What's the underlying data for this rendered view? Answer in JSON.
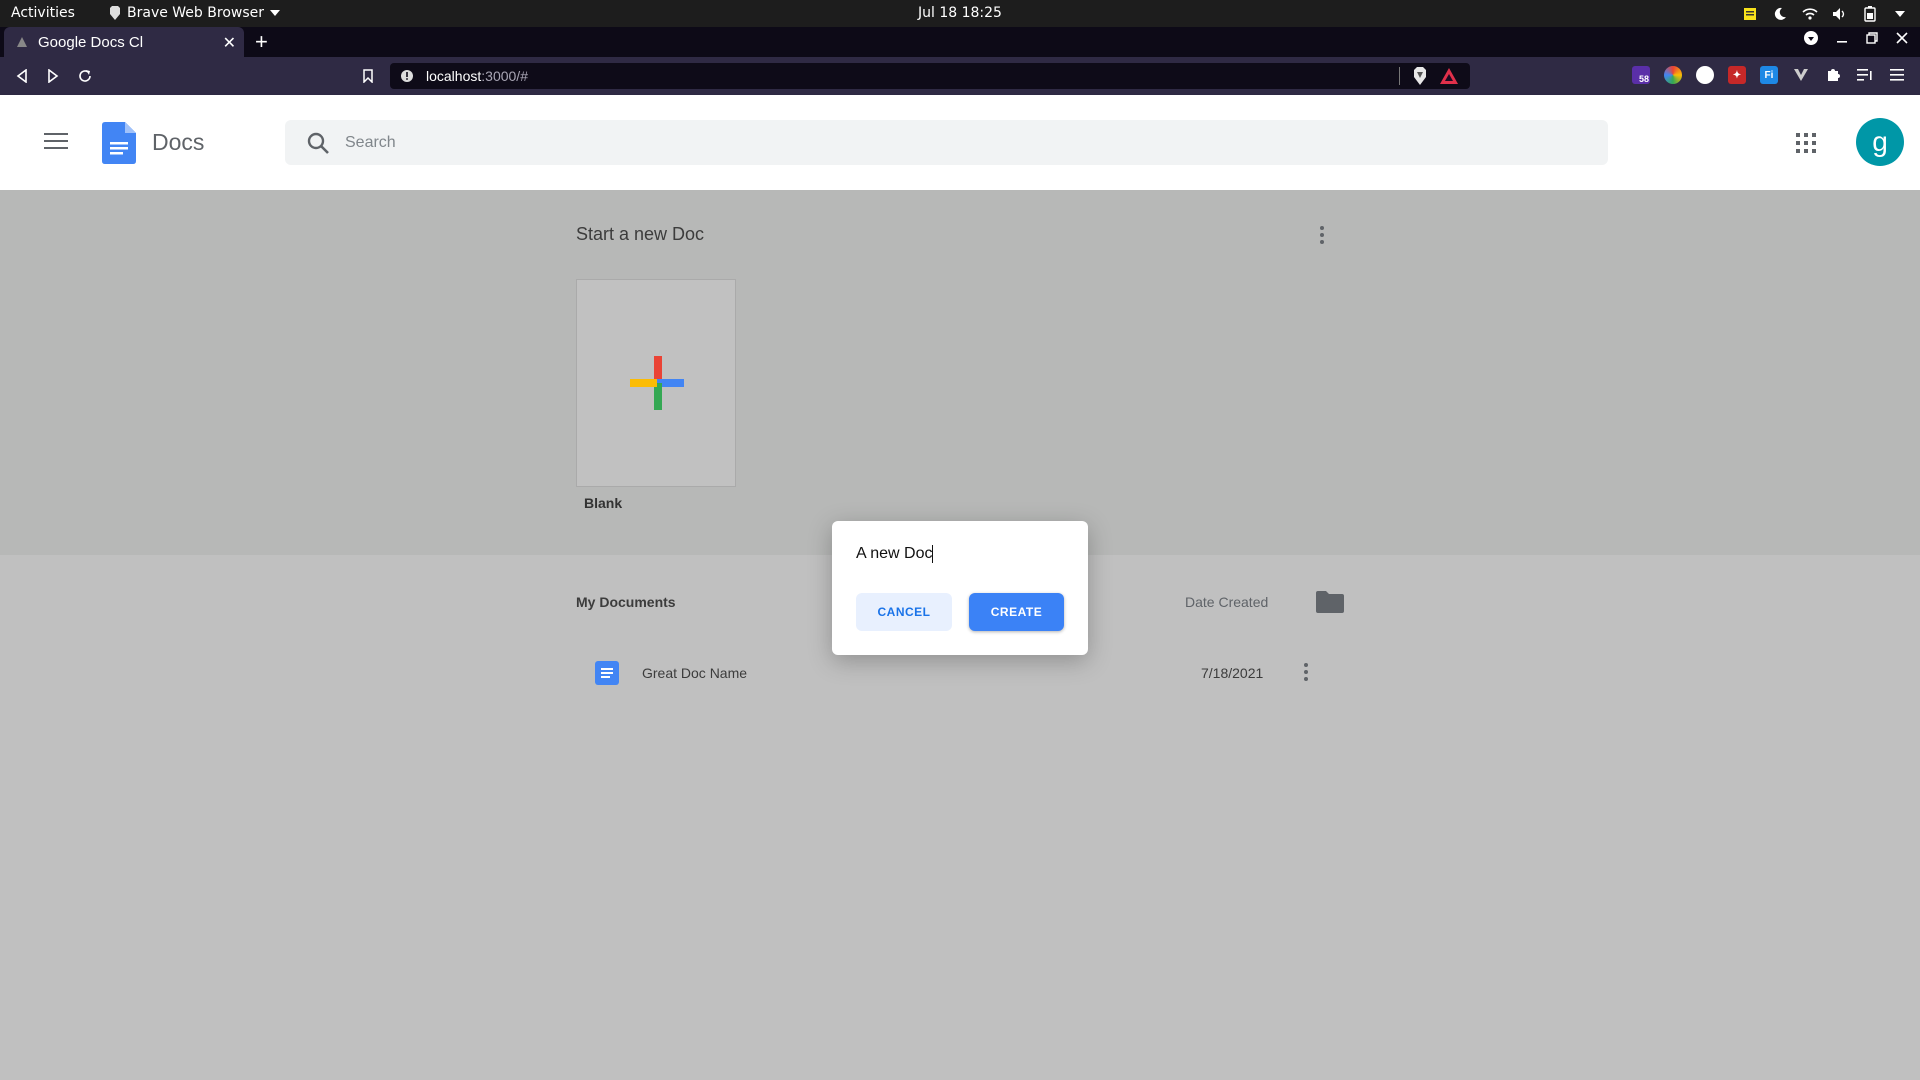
{
  "system": {
    "activities": "Activities",
    "app_menu": "Brave Web Browser",
    "clock": "Jul 18  18:25"
  },
  "browser": {
    "tab_title": "Google Docs Cl",
    "url_host": "localhost",
    "url_path": ":3000/#",
    "ext_badge": "58"
  },
  "app": {
    "title": "Docs",
    "search_placeholder": "Search",
    "avatar_letter": "g"
  },
  "start": {
    "heading": "Start a new Doc",
    "blank_label": "Blank"
  },
  "documents": {
    "heading": "My Documents",
    "date_column": "Date Created",
    "rows": [
      {
        "name": "Great Doc Name",
        "date": "7/18/2021"
      }
    ]
  },
  "dialog": {
    "input_value": "A new Doc",
    "cancel_label": "CANCEL",
    "create_label": "CREATE"
  },
  "colors": {
    "accent": "#1a73e8",
    "create_button": "#3b82f6",
    "avatar": "#0097a7",
    "docs_blue": "#4285f4"
  }
}
